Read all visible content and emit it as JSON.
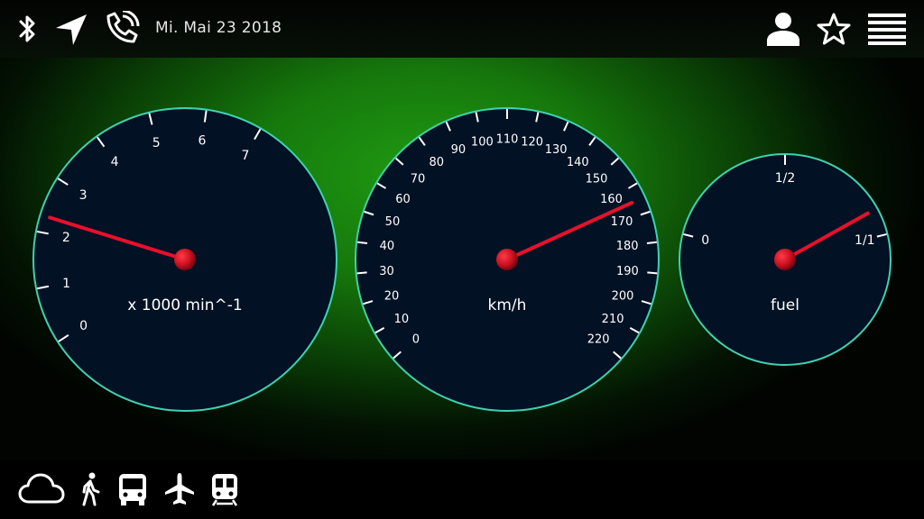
{
  "status_bar": {
    "date": "Mi. Mai 23 2018",
    "left_icons": [
      "bluetooth-icon",
      "navigation-arrow-icon",
      "phone-call-icon"
    ],
    "right_icons": [
      "user-icon",
      "star-outline-icon",
      "menu-icon"
    ]
  },
  "gauges": {
    "tachometer": {
      "unit_label": "x 1000 min^-1",
      "ticks": [
        "0",
        "1",
        "2",
        "3",
        "4",
        "5",
        "6",
        "7"
      ],
      "value": 2.3
    },
    "speedometer": {
      "unit_label": "km/h",
      "ticks": [
        "0",
        "10",
        "20",
        "30",
        "40",
        "50",
        "60",
        "70",
        "80",
        "90",
        "100",
        "110",
        "120",
        "130",
        "140",
        "150",
        "160",
        "170",
        "180",
        "190",
        "200",
        "210",
        "220"
      ],
      "value": 165
    },
    "fuel": {
      "unit_label": "fuel",
      "ticks": [
        "0",
        "1/2",
        "1/1"
      ],
      "value": 0.9
    }
  },
  "bottom_bar": {
    "icons": [
      "cloud-icon",
      "walking-icon",
      "bus-icon",
      "airplane-icon",
      "train-icon"
    ]
  },
  "colors": {
    "gauge_face": "#021124",
    "gauge_ring": "#3fd1b0",
    "needle": "#e8102c",
    "background_glow": "#1f9a12"
  }
}
